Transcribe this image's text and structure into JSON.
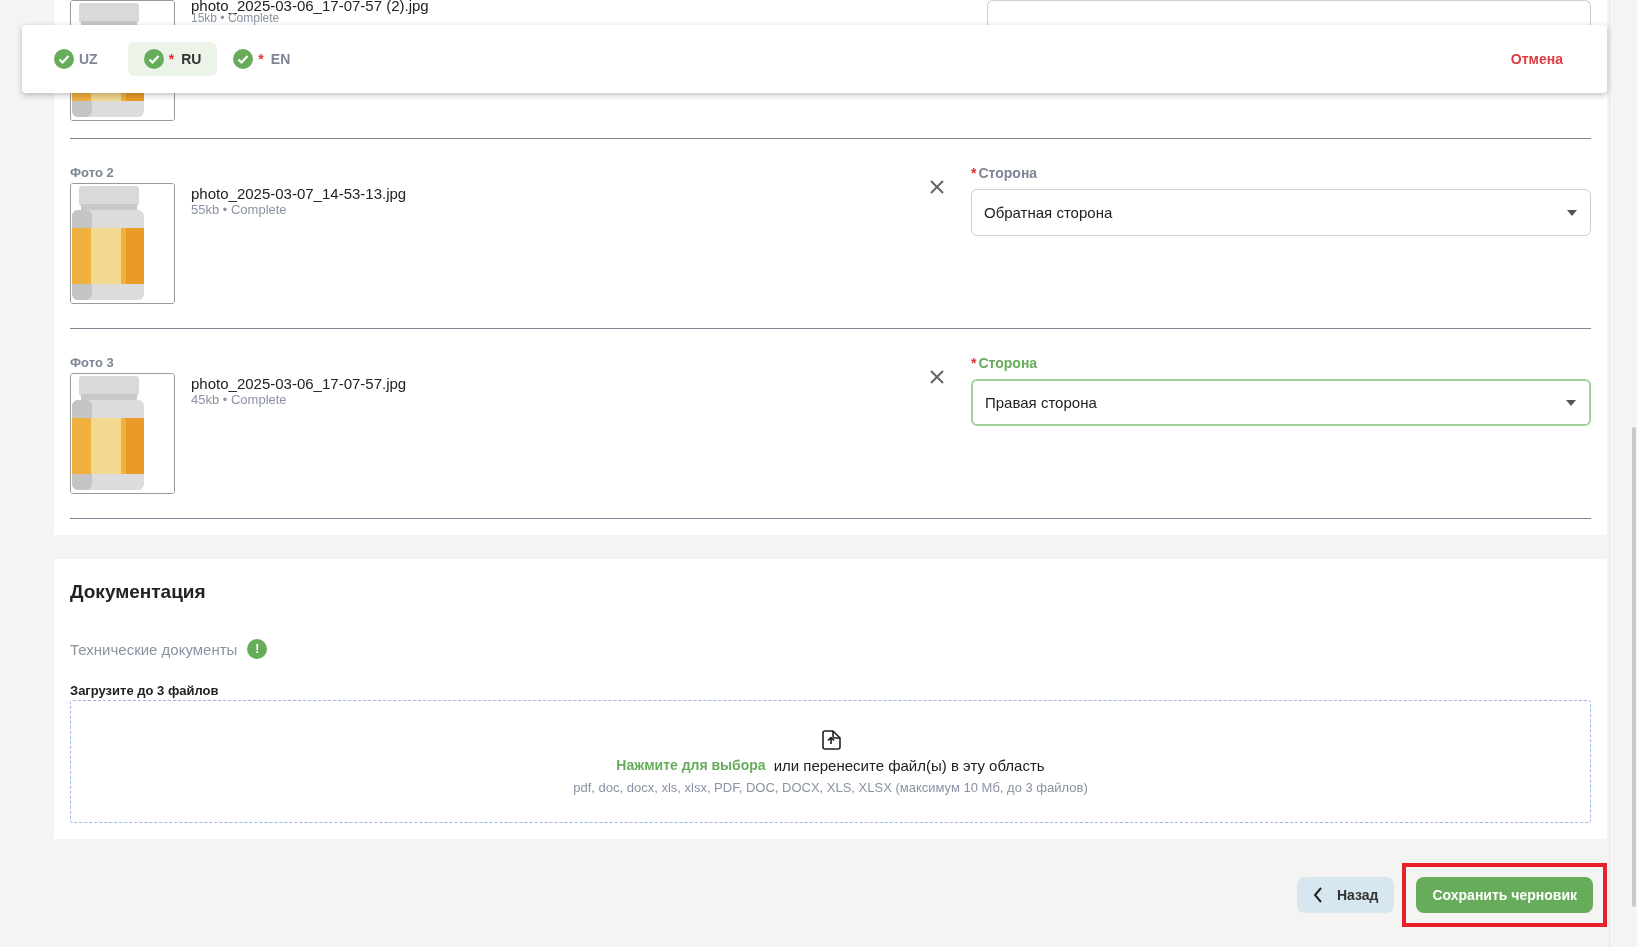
{
  "required_mark": "*",
  "language_tabs": [
    {
      "code": "UZ",
      "required": false,
      "complete": true,
      "selected": false
    },
    {
      "code": "RU",
      "required": true,
      "complete": true,
      "selected": true
    },
    {
      "code": "EN",
      "required": true,
      "complete": true,
      "selected": false
    }
  ],
  "cancel_button": "Отмена",
  "photos": [
    {
      "file_name": "photo_2025-03-06_17-07-57 (2).jpg",
      "meta": "15kb  •  Complete"
    },
    {
      "label": "Фото 2",
      "file_name": "photo_2025-03-07_14-53-13.jpg",
      "meta": "55kb  •  Complete",
      "side_label": "Сторона",
      "required": true,
      "side_value": "Обратная сторона",
      "focused": false
    },
    {
      "label": "Фото 3",
      "file_name": "photo_2025-03-06_17-07-57.jpg",
      "meta": "45kb  •  Complete",
      "side_label": "Сторона",
      "required": true,
      "side_value": "Правая сторона",
      "focused": true
    }
  ],
  "documentation": {
    "title": "Документация",
    "subtitle": "Технические документы",
    "info_badge": "!",
    "upload_label": "Загрузите до 3 файлов",
    "upload_link": "Нажмите для выбора",
    "upload_text": "или перенесите файл(ы) в эту область",
    "upload_hint": "pdf, doc, docx, xls, xlsx, PDF, DOC, DOCX, XLS, XLSX (максимум 10 Мб, до 3 файлов)"
  },
  "footer": {
    "back_button": "Назад",
    "save_button": {
      "label": "Сохранить черновик",
      "highlighted": true
    }
  }
}
